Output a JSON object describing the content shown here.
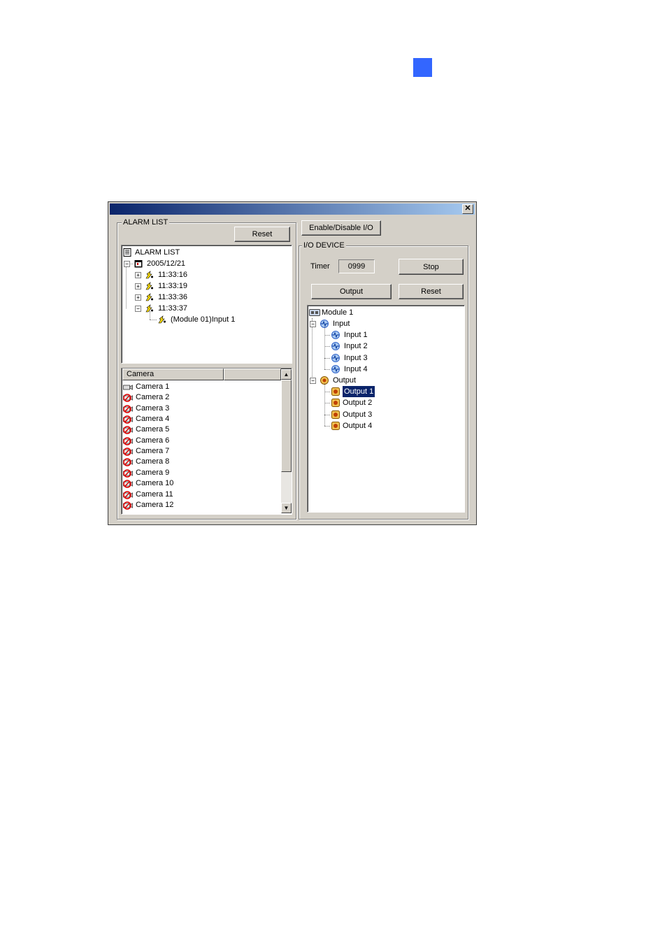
{
  "page": {
    "marker_color": "#3366ff"
  },
  "window": {
    "title": "",
    "close_glyph": "✕",
    "title_gradient": [
      "#0a246a",
      "#a6caf0"
    ]
  },
  "alarm_list": {
    "group_label": "ALARM LIST",
    "reset_label": "Reset",
    "tree": {
      "root": "ALARM LIST",
      "date": "2005/12/21",
      "times": [
        "11:33:16",
        "11:33:19",
        "11:33:36",
        "11:33:37"
      ],
      "event": "(Module 01)Input 1"
    }
  },
  "camera_list": {
    "columns": [
      "Camera",
      ""
    ],
    "rows": [
      "Camera 1",
      "Camera 2",
      "Camera 3",
      "Camera 4",
      "Camera 5",
      "Camera 6",
      "Camera 7",
      "Camera 8",
      "Camera 9",
      "Camera 10",
      "Camera 11",
      "Camera 12"
    ]
  },
  "io": {
    "enable_label": "Enable/Disable I/O",
    "group_label": "I/O DEVICE",
    "timer_label": "Timer",
    "timer_value": "0999",
    "stop_label": "Stop",
    "output_label": "Output",
    "reset_label": "Reset",
    "tree": {
      "module": "Module 1",
      "input_group": "Input",
      "inputs": [
        "Input 1",
        "Input 2",
        "Input 3",
        "Input 4"
      ],
      "output_group": "Output",
      "outputs": [
        "Output 1",
        "Output 2",
        "Output 3",
        "Output 4"
      ],
      "selected": "Output 1"
    }
  }
}
